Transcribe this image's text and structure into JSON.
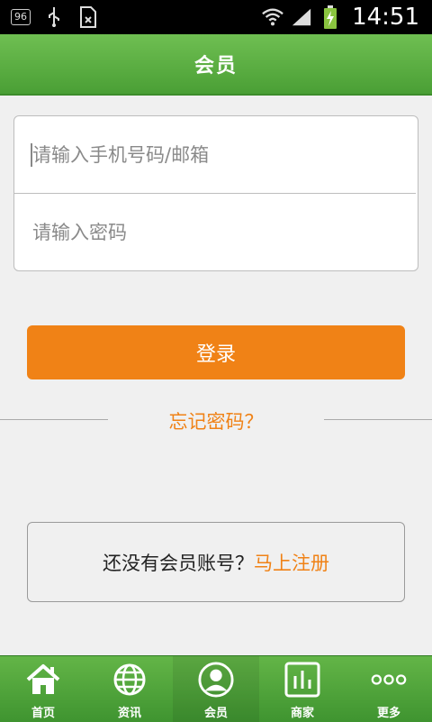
{
  "status_bar": {
    "notif_badge": "96",
    "time": "14:51"
  },
  "header": {
    "title": "会员"
  },
  "form": {
    "phone_placeholder": "请输入手机号码/邮箱",
    "password_placeholder": "请输入密码"
  },
  "login_label": "登录",
  "forgot_label": "忘记密码？",
  "register": {
    "prompt": "还没有会员账号？",
    "link": "马上注册"
  },
  "tabs": [
    {
      "label": "首页",
      "icon": "home-icon"
    },
    {
      "label": "资讯",
      "icon": "globe-icon"
    },
    {
      "label": "会员",
      "icon": "user-icon"
    },
    {
      "label": "商家",
      "icon": "chart-icon"
    },
    {
      "label": "更多",
      "icon": "more-icon"
    }
  ],
  "colors": {
    "green": "#4a9f35",
    "orange": "#f08216"
  }
}
